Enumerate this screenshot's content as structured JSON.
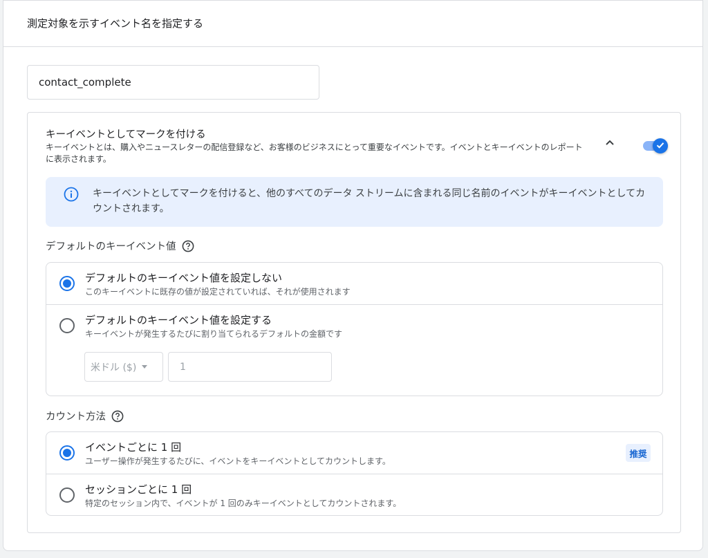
{
  "header": {
    "title": "測定対象を示すイベント名を指定する"
  },
  "event_name": {
    "value": "contact_complete"
  },
  "key_event": {
    "title": "キーイベントとしてマークを付ける",
    "description": "キーイベントとは、購入やニュースレターの配信登録など、お客様のビジネスにとって重要なイベントです。イベントとキーイベントのレポートに表示されます。",
    "toggle_on": true,
    "chevron_icon": "chevron-up-icon",
    "toggle_icon": "check-icon"
  },
  "info": {
    "icon": "info-icon",
    "text": "キーイベントとしてマークを付けると、他のすべてのデータ ストリームに含まれる同じ名前のイベントがキーイベントとしてカウントされます。"
  },
  "default_value": {
    "label": "デフォルトのキーイベント値",
    "help_icon": "help-icon",
    "options": [
      {
        "title": "デフォルトのキーイベント値を設定しない",
        "description": "このキーイベントに既存の値が設定されていれば、それが使用されます",
        "selected": true
      },
      {
        "title": "デフォルトのキーイベント値を設定する",
        "description": "キーイベントが発生するたびに割り当てられるデフォルトの金額です",
        "selected": false
      }
    ],
    "currency": "米ドル ($)",
    "amount": "1"
  },
  "counting": {
    "label": "カウント方法",
    "help_icon": "help-icon",
    "options": [
      {
        "title": "イベントごとに 1 回",
        "description": "ユーザー操作が発生するたびに、イベントをキーイベントとしてカウントします。",
        "selected": true,
        "badge": "推奨"
      },
      {
        "title": "セッションごとに 1 回",
        "description": "特定のセッション内で、イベントが 1 回のみキーイベントとしてカウントされます。",
        "selected": false
      }
    ]
  },
  "colors": {
    "accent": "#1a73e8",
    "info_bg": "#e8f0fe",
    "border": "#dadce0"
  }
}
